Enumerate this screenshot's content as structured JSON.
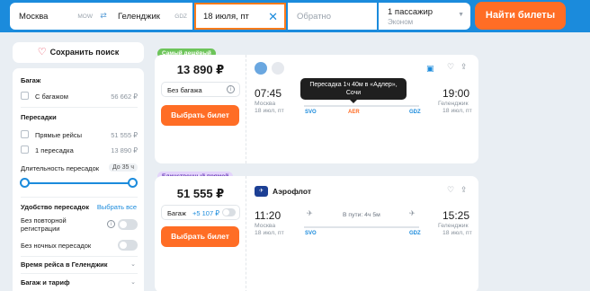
{
  "search": {
    "from": "Москва",
    "from_code": "MOW",
    "swap_icon": "⇄",
    "to": "Геленджик",
    "to_code": "GDZ",
    "date": "18 июля, пт",
    "return_placeholder": "Обратно",
    "passengers": "1 пассажир",
    "class": "Эконом",
    "find_button": "Найти билеты",
    "accent": "#ff6d25",
    "brand": "#1b8bdc"
  },
  "sidebar": {
    "save_search": "Сохранить поиск",
    "baggage_title": "Багаж",
    "with_baggage": "С багажом",
    "with_baggage_price": "56 662 ₽",
    "transfers_title": "Пересадки",
    "direct": "Прямые рейсы",
    "direct_price": "51 555 ₽",
    "one_transfer": "1 пересадка",
    "one_transfer_price": "13 890 ₽",
    "duration_label": "Длительность пересадок",
    "duration_value": "До 35 ч",
    "comfort_title": "Удобство пересадок",
    "select_all": "Выбрать все",
    "no_recheck": "Без повторной регистрации",
    "no_night": "Без ночных пересадок",
    "time_section": "Время рейса в Геленджик",
    "baggage_tariff": "Багаж и тариф"
  },
  "tickets": [
    {
      "badge": "Самый дешёвый",
      "price": "13 890 ₽",
      "bag_option": "Без багажа",
      "choose": "Выбрать билет",
      "dep_time": "07:45",
      "dep_city": "Москва",
      "dep_date": "18 июл, пт",
      "dep_code": "SVO",
      "transfer_code": "AER",
      "arr_time": "19:00",
      "arr_city": "Геленджик",
      "arr_date": "18 июл, пт",
      "arr_code": "GDZ",
      "tooltip_line1": "Пересадка 1ч 40м в «Адлер»,",
      "tooltip_line2": "Сочи"
    },
    {
      "badge": "Единственный прямой",
      "price": "51 555 ₽",
      "bag_option": "Багаж",
      "bag_extra": "+5 107 ₽",
      "choose": "Выбрать билет",
      "airline": "Аэрофлот",
      "dep_time": "11:20",
      "dep_city": "Москва",
      "dep_date": "18 июл, пт",
      "dep_code": "SVO",
      "duration": "В пути: 4ч 5м",
      "arr_time": "15:25",
      "arr_city": "Геленджик",
      "arr_date": "18 июл, пт",
      "arr_code": "GDZ"
    }
  ]
}
